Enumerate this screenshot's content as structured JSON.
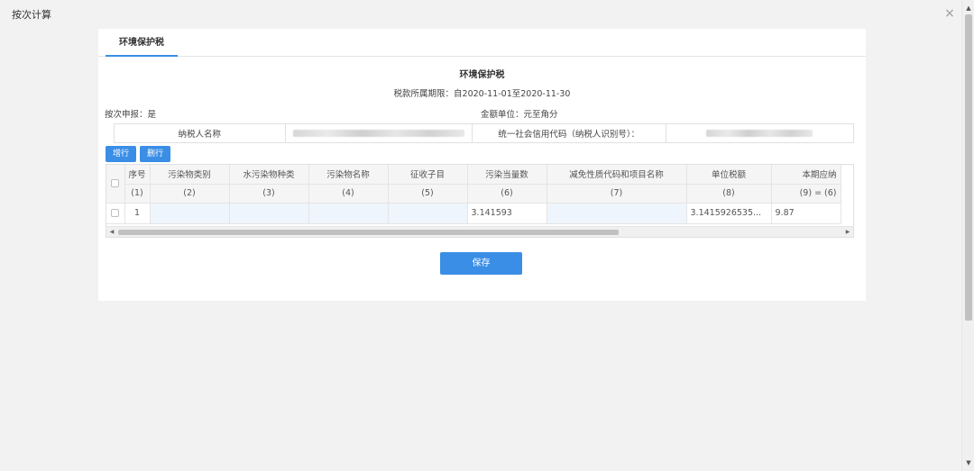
{
  "window": {
    "title": "按次计算",
    "close_glyph": "×"
  },
  "tabs": [
    {
      "label": "环境保护税"
    }
  ],
  "form": {
    "title": "环境保护税",
    "period": "税款所属期限：自2020-11-01至2020-11-30",
    "per_time_declare": "按次申报：是",
    "amount_unit": "金额单位：元至角分"
  },
  "taxpayer": {
    "name_label": "纳税人名称",
    "credit_code_label": "统一社会信用代码（纳税人识别号）："
  },
  "toolbar": {
    "add_row": "增行",
    "delete_row": "删行"
  },
  "table": {
    "headers": [
      "序号",
      "污染物类别",
      "水污染物种类",
      "污染物名称",
      "征收子目",
      "污染当量数",
      "减免性质代码和项目名称",
      "单位税额",
      "本期应纳"
    ],
    "codes": [
      "(1)",
      "(2)",
      "(3)",
      "(4)",
      "(5)",
      "(6)",
      "(7)",
      "(8)",
      "(9) = (6)"
    ],
    "rows": [
      {
        "seq": "1",
        "pollutant_category": "",
        "water_pollutant_type": "",
        "pollutant_name": "",
        "levy_item": "",
        "pollution_equivalent": "3.141593",
        "relief_code": "",
        "unit_tax": "3.1415926535...",
        "current_tax": "9.87"
      }
    ]
  },
  "actions": {
    "save": "保存"
  },
  "icons": {
    "close": "close-icon",
    "scroll_up": "chevron-up-icon",
    "scroll_down": "chevron-down-icon",
    "scroll_left": "chevron-left-icon",
    "scroll_right": "chevron-right-icon"
  },
  "colors": {
    "accent": "#3a8ee6",
    "editable_cell": "#eef5fc"
  }
}
